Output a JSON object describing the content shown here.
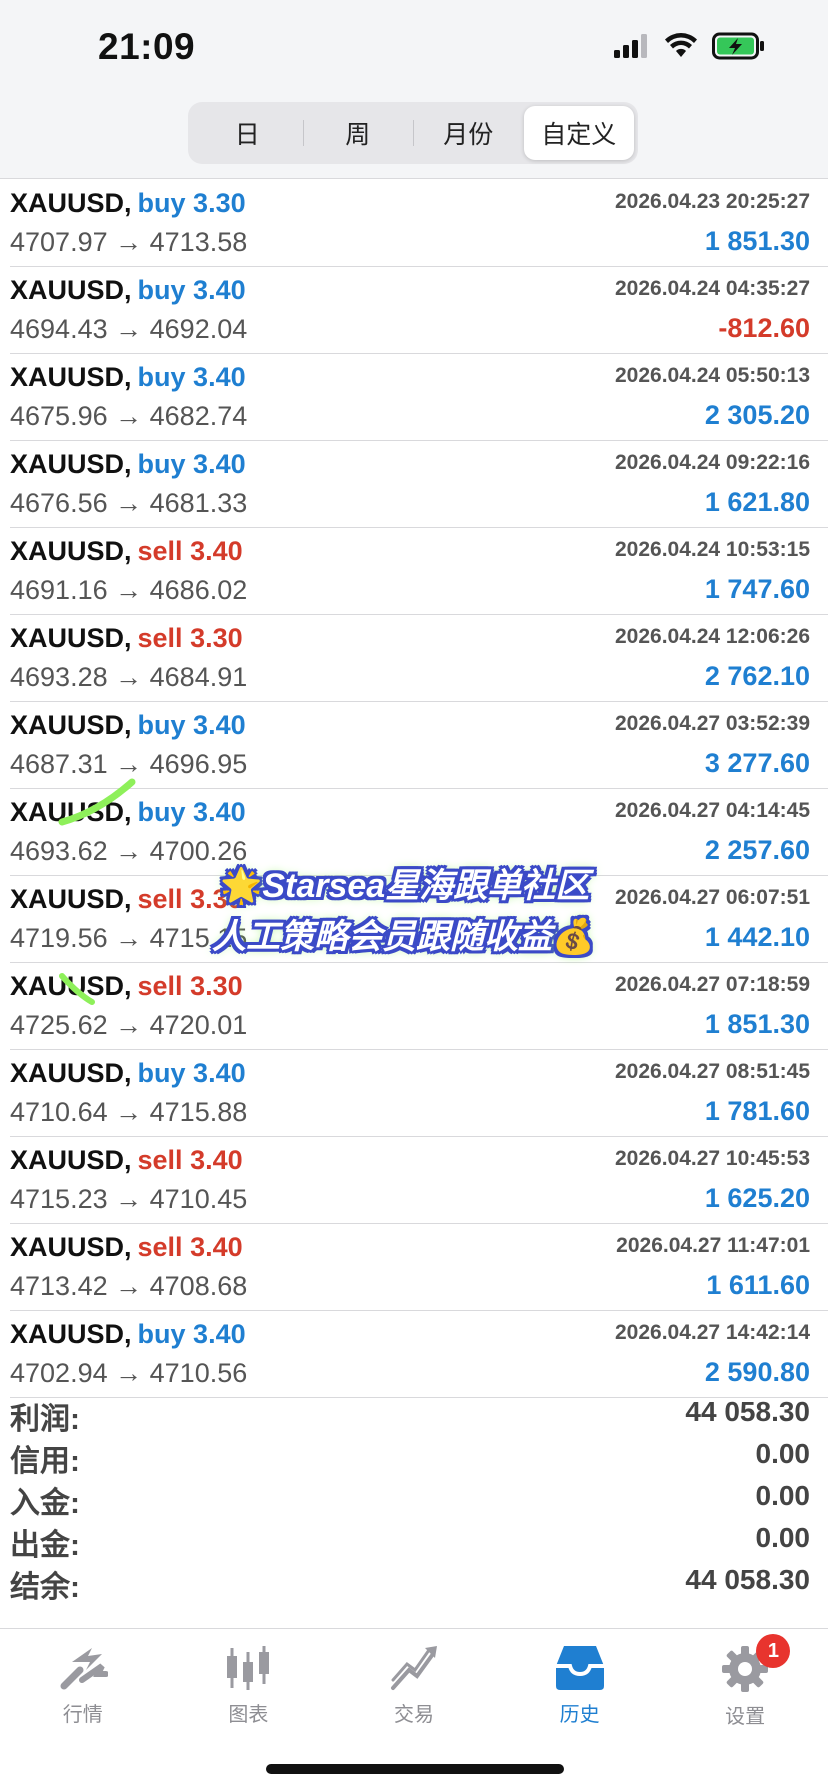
{
  "status_bar": {
    "time": "21:09"
  },
  "segments": [
    {
      "label": "日",
      "active": false
    },
    {
      "label": "周",
      "active": false
    },
    {
      "label": "月份",
      "active": false
    },
    {
      "label": "自定义",
      "active": true
    }
  ],
  "deals": [
    {
      "symbol": "XAUUSD,",
      "side": "buy",
      "volume": "3.30",
      "open": "4707.97",
      "close": "4713.58",
      "datetime": "2026.04.23 20:25:27",
      "profit": "1 851.30"
    },
    {
      "symbol": "XAUUSD,",
      "side": "buy",
      "volume": "3.40",
      "open": "4694.43",
      "close": "4692.04",
      "datetime": "2026.04.24 04:35:27",
      "profit": "-812.60"
    },
    {
      "symbol": "XAUUSD,",
      "side": "buy",
      "volume": "3.40",
      "open": "4675.96",
      "close": "4682.74",
      "datetime": "2026.04.24 05:50:13",
      "profit": "2 305.20"
    },
    {
      "symbol": "XAUUSD,",
      "side": "buy",
      "volume": "3.40",
      "open": "4676.56",
      "close": "4681.33",
      "datetime": "2026.04.24 09:22:16",
      "profit": "1 621.80"
    },
    {
      "symbol": "XAUUSD,",
      "side": "sell",
      "volume": "3.40",
      "open": "4691.16",
      "close": "4686.02",
      "datetime": "2026.04.24 10:53:15",
      "profit": "1 747.60"
    },
    {
      "symbol": "XAUUSD,",
      "side": "sell",
      "volume": "3.30",
      "open": "4693.28",
      "close": "4684.91",
      "datetime": "2026.04.24 12:06:26",
      "profit": "2 762.10"
    },
    {
      "symbol": "XAUUSD,",
      "side": "buy",
      "volume": "3.40",
      "open": "4687.31",
      "close": "4696.95",
      "datetime": "2026.04.27 03:52:39",
      "profit": "3 277.60"
    },
    {
      "symbol": "XAUUSD,",
      "side": "buy",
      "volume": "3.40",
      "open": "4693.62",
      "close": "4700.26",
      "datetime": "2026.04.27 04:14:45",
      "profit": "2 257.60"
    },
    {
      "symbol": "XAUUSD,",
      "side": "sell",
      "volume": "3.30",
      "open": "4719.56",
      "close": "4715.15",
      "datetime": "2026.04.27 06:07:51",
      "profit": "1 442.10"
    },
    {
      "symbol": "XAUUSD,",
      "side": "sell",
      "volume": "3.30",
      "open": "4725.62",
      "close": "4720.01",
      "datetime": "2026.04.27 07:18:59",
      "profit": "1 851.30"
    },
    {
      "symbol": "XAUUSD,",
      "side": "buy",
      "volume": "3.40",
      "open": "4710.64",
      "close": "4715.88",
      "datetime": "2026.04.27 08:51:45",
      "profit": "1 781.60"
    },
    {
      "symbol": "XAUUSD,",
      "side": "sell",
      "volume": "3.40",
      "open": "4715.23",
      "close": "4710.45",
      "datetime": "2026.04.27 10:45:53",
      "profit": "1 625.20"
    },
    {
      "symbol": "XAUUSD,",
      "side": "sell",
      "volume": "3.40",
      "open": "4713.42",
      "close": "4708.68",
      "datetime": "2026.04.27 11:47:01",
      "profit": "1 611.60"
    },
    {
      "symbol": "XAUUSD,",
      "side": "buy",
      "volume": "3.40",
      "open": "4702.94",
      "close": "4710.56",
      "datetime": "2026.04.27 14:42:14",
      "profit": "2 590.80"
    }
  ],
  "arrow": "→",
  "summary": [
    {
      "label": "利润:",
      "value": "44 058.30"
    },
    {
      "label": "信用:",
      "value": "0.00"
    },
    {
      "label": "入金:",
      "value": "0.00"
    },
    {
      "label": "出金:",
      "value": "0.00"
    },
    {
      "label": "结余:",
      "value": "44 058.30"
    }
  ],
  "watermark": {
    "line1": "Starsea星海跟单社区",
    "line2": "人工策略会员跟随收益",
    "star": "🌟",
    "money": "💰"
  },
  "tabs": [
    {
      "label": "行情",
      "icon": "quotes-icon",
      "active": false
    },
    {
      "label": "图表",
      "icon": "chart-icon",
      "active": false
    },
    {
      "label": "交易",
      "icon": "trade-icon",
      "active": false
    },
    {
      "label": "历史",
      "icon": "history-icon",
      "active": true
    },
    {
      "label": "设置",
      "icon": "settings-icon",
      "active": false,
      "badge": "1"
    }
  ],
  "colors": {
    "buy": "#1f7fd1",
    "sell": "#d43b2a",
    "accent": "#1f7fd1",
    "badge": "#e8342e"
  }
}
